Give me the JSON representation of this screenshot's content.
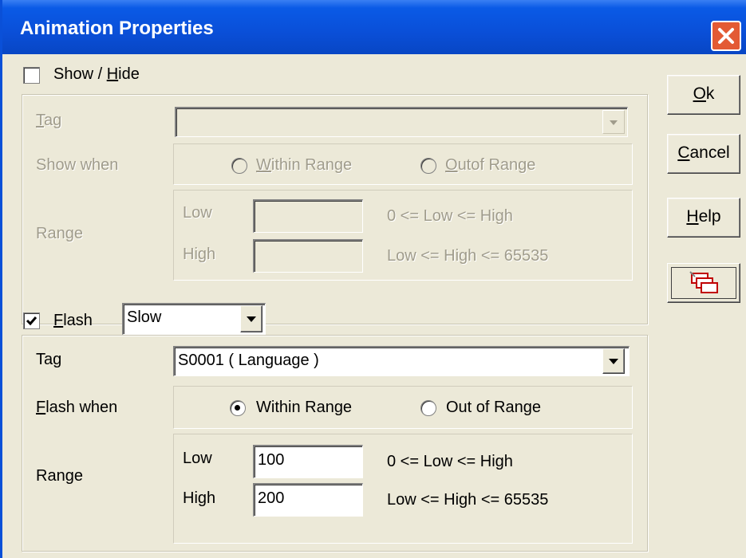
{
  "window": {
    "title": "Animation Properties"
  },
  "buttons": {
    "ok": "Ok",
    "cancel": "Cancel",
    "help": "Help"
  },
  "show_hide": {
    "label": "Show / Hide",
    "checked": false,
    "tag_label": "Tag",
    "tag_value": "",
    "show_when_label": "Show when",
    "within_range": "Within Range",
    "out_of_range": "Outof Range",
    "range_label": "Range",
    "low_label": "Low",
    "high_label": "High",
    "low_value": "",
    "high_value": "",
    "low_hint": "0 <= Low <= High",
    "high_hint": "Low <= High <= 65535"
  },
  "flash": {
    "label": "Flash",
    "checked": true,
    "speed": "Slow",
    "tag_label": "Tag",
    "tag_value": "S0001 ( Language )",
    "flash_when_label": "Flash when",
    "within_range": "Within Range",
    "out_of_range": "Out of Range",
    "selected": "Within Range",
    "range_label": "Range",
    "low_label": "Low",
    "high_label": "High",
    "low_value": "100",
    "high_value": "200",
    "low_hint": "0 <= Low <= High",
    "high_hint": "Low <= High <= 65535"
  }
}
